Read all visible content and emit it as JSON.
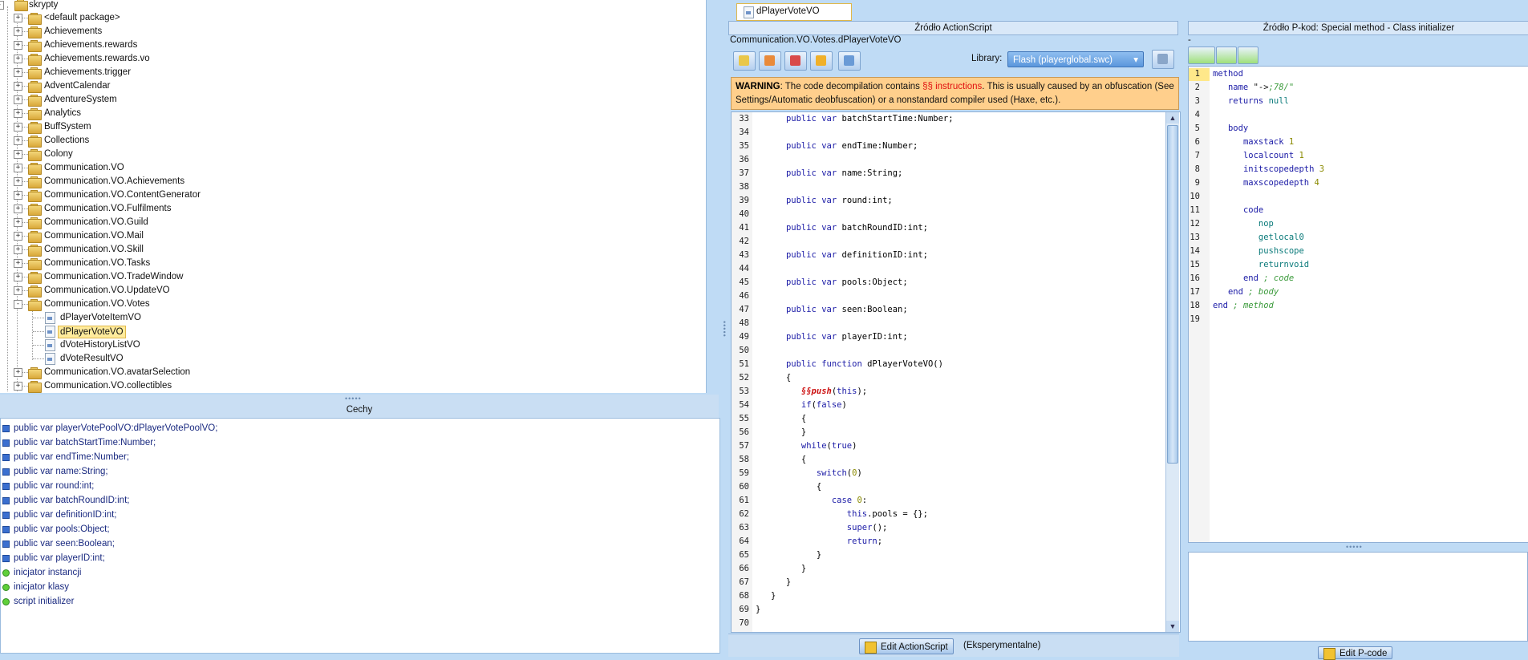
{
  "tree": {
    "root": "skrypty",
    "items": [
      {
        "label": "<default package>",
        "type": "folder",
        "expand": "+"
      },
      {
        "label": "Achievements",
        "type": "folder",
        "expand": "+"
      },
      {
        "label": "Achievements.rewards",
        "type": "folder",
        "expand": "+"
      },
      {
        "label": "Achievements.rewards.vo",
        "type": "folder",
        "expand": "+"
      },
      {
        "label": "Achievements.trigger",
        "type": "folder",
        "expand": "+"
      },
      {
        "label": "AdventCalendar",
        "type": "folder",
        "expand": "+"
      },
      {
        "label": "AdventureSystem",
        "type": "folder",
        "expand": "+"
      },
      {
        "label": "Analytics",
        "type": "folder",
        "expand": "+"
      },
      {
        "label": "BuffSystem",
        "type": "folder",
        "expand": "+"
      },
      {
        "label": "Collections",
        "type": "folder",
        "expand": "+"
      },
      {
        "label": "Colony",
        "type": "folder",
        "expand": "+"
      },
      {
        "label": "Communication.VO",
        "type": "folder",
        "expand": "+"
      },
      {
        "label": "Communication.VO.Achievements",
        "type": "folder",
        "expand": "+"
      },
      {
        "label": "Communication.VO.ContentGenerator",
        "type": "folder",
        "expand": "+"
      },
      {
        "label": "Communication.VO.Fulfilments",
        "type": "folder",
        "expand": "+"
      },
      {
        "label": "Communication.VO.Guild",
        "type": "folder",
        "expand": "+"
      },
      {
        "label": "Communication.VO.Mail",
        "type": "folder",
        "expand": "+"
      },
      {
        "label": "Communication.VO.Skill",
        "type": "folder",
        "expand": "+"
      },
      {
        "label": "Communication.VO.Tasks",
        "type": "folder",
        "expand": "+"
      },
      {
        "label": "Communication.VO.TradeWindow",
        "type": "folder",
        "expand": "+"
      },
      {
        "label": "Communication.VO.UpdateVO",
        "type": "folder",
        "expand": "+"
      },
      {
        "label": "Communication.VO.Votes",
        "type": "folder",
        "expand": "-"
      },
      {
        "label": "dPlayerVoteItemVO",
        "type": "file"
      },
      {
        "label": "dPlayerVoteVO",
        "type": "file",
        "selected": true
      },
      {
        "label": "dVoteHistoryListVO",
        "type": "file"
      },
      {
        "label": "dVoteResultVO",
        "type": "file"
      },
      {
        "label": "Communication.VO.avatarSelection",
        "type": "folder",
        "expand": "+"
      },
      {
        "label": "Communication.VO.collectibles",
        "type": "folder",
        "expand": "+"
      }
    ]
  },
  "traits": {
    "title": "Cechy",
    "items": [
      {
        "label": "public var playerVotePoolVO:dPlayerVotePoolVO;",
        "kind": "var"
      },
      {
        "label": "public var batchStartTime:Number;",
        "kind": "var"
      },
      {
        "label": "public var endTime:Number;",
        "kind": "var"
      },
      {
        "label": "public var name:String;",
        "kind": "var"
      },
      {
        "label": "public var round:int;",
        "kind": "var"
      },
      {
        "label": "public var batchRoundID:int;",
        "kind": "var"
      },
      {
        "label": "public var definitionID:int;",
        "kind": "var"
      },
      {
        "label": "public var pools:Object;",
        "kind": "var"
      },
      {
        "label": "public var seen:Boolean;",
        "kind": "var"
      },
      {
        "label": "public var playerID:int;",
        "kind": "var"
      },
      {
        "label": "inicjator instancji",
        "kind": "init"
      },
      {
        "label": "inicjator klasy",
        "kind": "init"
      },
      {
        "label": "script initializer",
        "kind": "init"
      }
    ]
  },
  "center": {
    "tab": "dPlayerVoteVO",
    "title": "Źródło ActionScript",
    "path": "Communication.VO.Votes.dPlayerVoteVO",
    "library_label": "Library:",
    "library_value": "Flash (playerglobal.swc)",
    "warning_bold": "WARNING",
    "warning_pre": ": The code decompilation contains ",
    "warning_red": "§§ instructions",
    "warning_post": ". This is usually caused by an obfuscation (See Settings/Automatic deobfuscation) or a nonstandard compiler used (Haxe, etc.).",
    "code": [
      {
        "n": "33",
        "t": "      public var batchStartTime:Number;"
      },
      {
        "n": "34",
        "t": ""
      },
      {
        "n": "35",
        "t": "      public var endTime:Number;"
      },
      {
        "n": "36",
        "t": ""
      },
      {
        "n": "37",
        "t": "      public var name:String;"
      },
      {
        "n": "38",
        "t": ""
      },
      {
        "n": "39",
        "t": "      public var round:int;"
      },
      {
        "n": "40",
        "t": ""
      },
      {
        "n": "41",
        "t": "      public var batchRoundID:int;"
      },
      {
        "n": "42",
        "t": ""
      },
      {
        "n": "43",
        "t": "      public var definitionID:int;"
      },
      {
        "n": "44",
        "t": ""
      },
      {
        "n": "45",
        "t": "      public var pools:Object;"
      },
      {
        "n": "46",
        "t": ""
      },
      {
        "n": "47",
        "t": "      public var seen:Boolean;"
      },
      {
        "n": "48",
        "t": ""
      },
      {
        "n": "49",
        "t": "      public var playerID:int;"
      },
      {
        "n": "50",
        "t": ""
      },
      {
        "n": "51",
        "t": "      public function dPlayerVoteVO()"
      },
      {
        "n": "52",
        "t": "      {"
      },
      {
        "n": "53",
        "t": "         §§push(this);"
      },
      {
        "n": "54",
        "t": "         if(false)"
      },
      {
        "n": "55",
        "t": "         {"
      },
      {
        "n": "56",
        "t": "         }"
      },
      {
        "n": "57",
        "t": "         while(true)"
      },
      {
        "n": "58",
        "t": "         {"
      },
      {
        "n": "59",
        "t": "            switch(0)"
      },
      {
        "n": "60",
        "t": "            {"
      },
      {
        "n": "61",
        "t": "               case 0:"
      },
      {
        "n": "62",
        "t": "                  this.pools = {};"
      },
      {
        "n": "63",
        "t": "                  super();"
      },
      {
        "n": "64",
        "t": "                  return;"
      },
      {
        "n": "65",
        "t": "            }"
      },
      {
        "n": "66",
        "t": "         }"
      },
      {
        "n": "67",
        "t": "      }"
      },
      {
        "n": "68",
        "t": "   }"
      },
      {
        "n": "69",
        "t": "}"
      },
      {
        "n": "70",
        "t": ""
      }
    ],
    "edit_button": "Edit ActionScript",
    "edit_note": "(Eksperymentalne)"
  },
  "right": {
    "title": "Źródło P-kod: Special method - Class initializer",
    "subtitle": "-",
    "pcode": [
      {
        "n": "1",
        "t": "method"
      },
      {
        "n": "2",
        "t": "   name \"->78/\""
      },
      {
        "n": "3",
        "t": "   returns null"
      },
      {
        "n": "4",
        "t": ""
      },
      {
        "n": "5",
        "t": "   body"
      },
      {
        "n": "6",
        "t": "      maxstack 1"
      },
      {
        "n": "7",
        "t": "      localcount 1"
      },
      {
        "n": "8",
        "t": "      initscopedepth 3"
      },
      {
        "n": "9",
        "t": "      maxscopedepth 4"
      },
      {
        "n": "10",
        "t": ""
      },
      {
        "n": "11",
        "t": "      code"
      },
      {
        "n": "12",
        "t": "         nop"
      },
      {
        "n": "13",
        "t": "         getlocal0"
      },
      {
        "n": "14",
        "t": "         pushscope"
      },
      {
        "n": "15",
        "t": "         returnvoid"
      },
      {
        "n": "16",
        "t": "      end ; code"
      },
      {
        "n": "17",
        "t": "   end ; body"
      },
      {
        "n": "18",
        "t": "end ; method"
      },
      {
        "n": "19",
        "t": ""
      }
    ],
    "edit_button": "Edit P-code"
  }
}
